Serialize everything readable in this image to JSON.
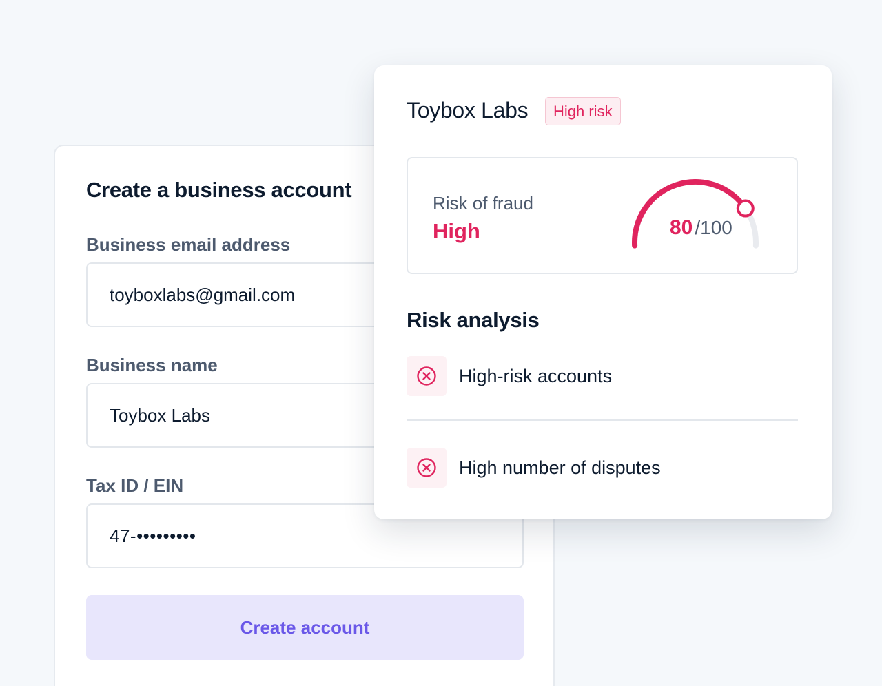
{
  "form": {
    "title": "Create a business account",
    "fields": [
      {
        "label": "Business email address",
        "value": "toyboxlabs@gmail.com"
      },
      {
        "label": "Business name",
        "value": "Toybox Labs"
      },
      {
        "label": "Tax ID / EIN",
        "value": "47-•••••••••"
      }
    ],
    "submit_label": "Create account"
  },
  "risk_panel": {
    "company": "Toybox Labs",
    "badge": "High risk",
    "score": {
      "label": "Risk of fraud",
      "level": "High",
      "value": "80",
      "max": "/100",
      "fraction": 0.8
    },
    "analysis_title": "Risk analysis",
    "items": [
      {
        "icon": "x-circle-icon",
        "text": "High-risk accounts"
      },
      {
        "icon": "x-circle-icon",
        "text": "High number of disputes"
      }
    ]
  },
  "colors": {
    "accent_danger": "#e0245e",
    "button_bg": "#e8e6fc",
    "button_text": "#6a58e8",
    "heading": "#0d1b2e",
    "muted": "#4d5a6e"
  }
}
